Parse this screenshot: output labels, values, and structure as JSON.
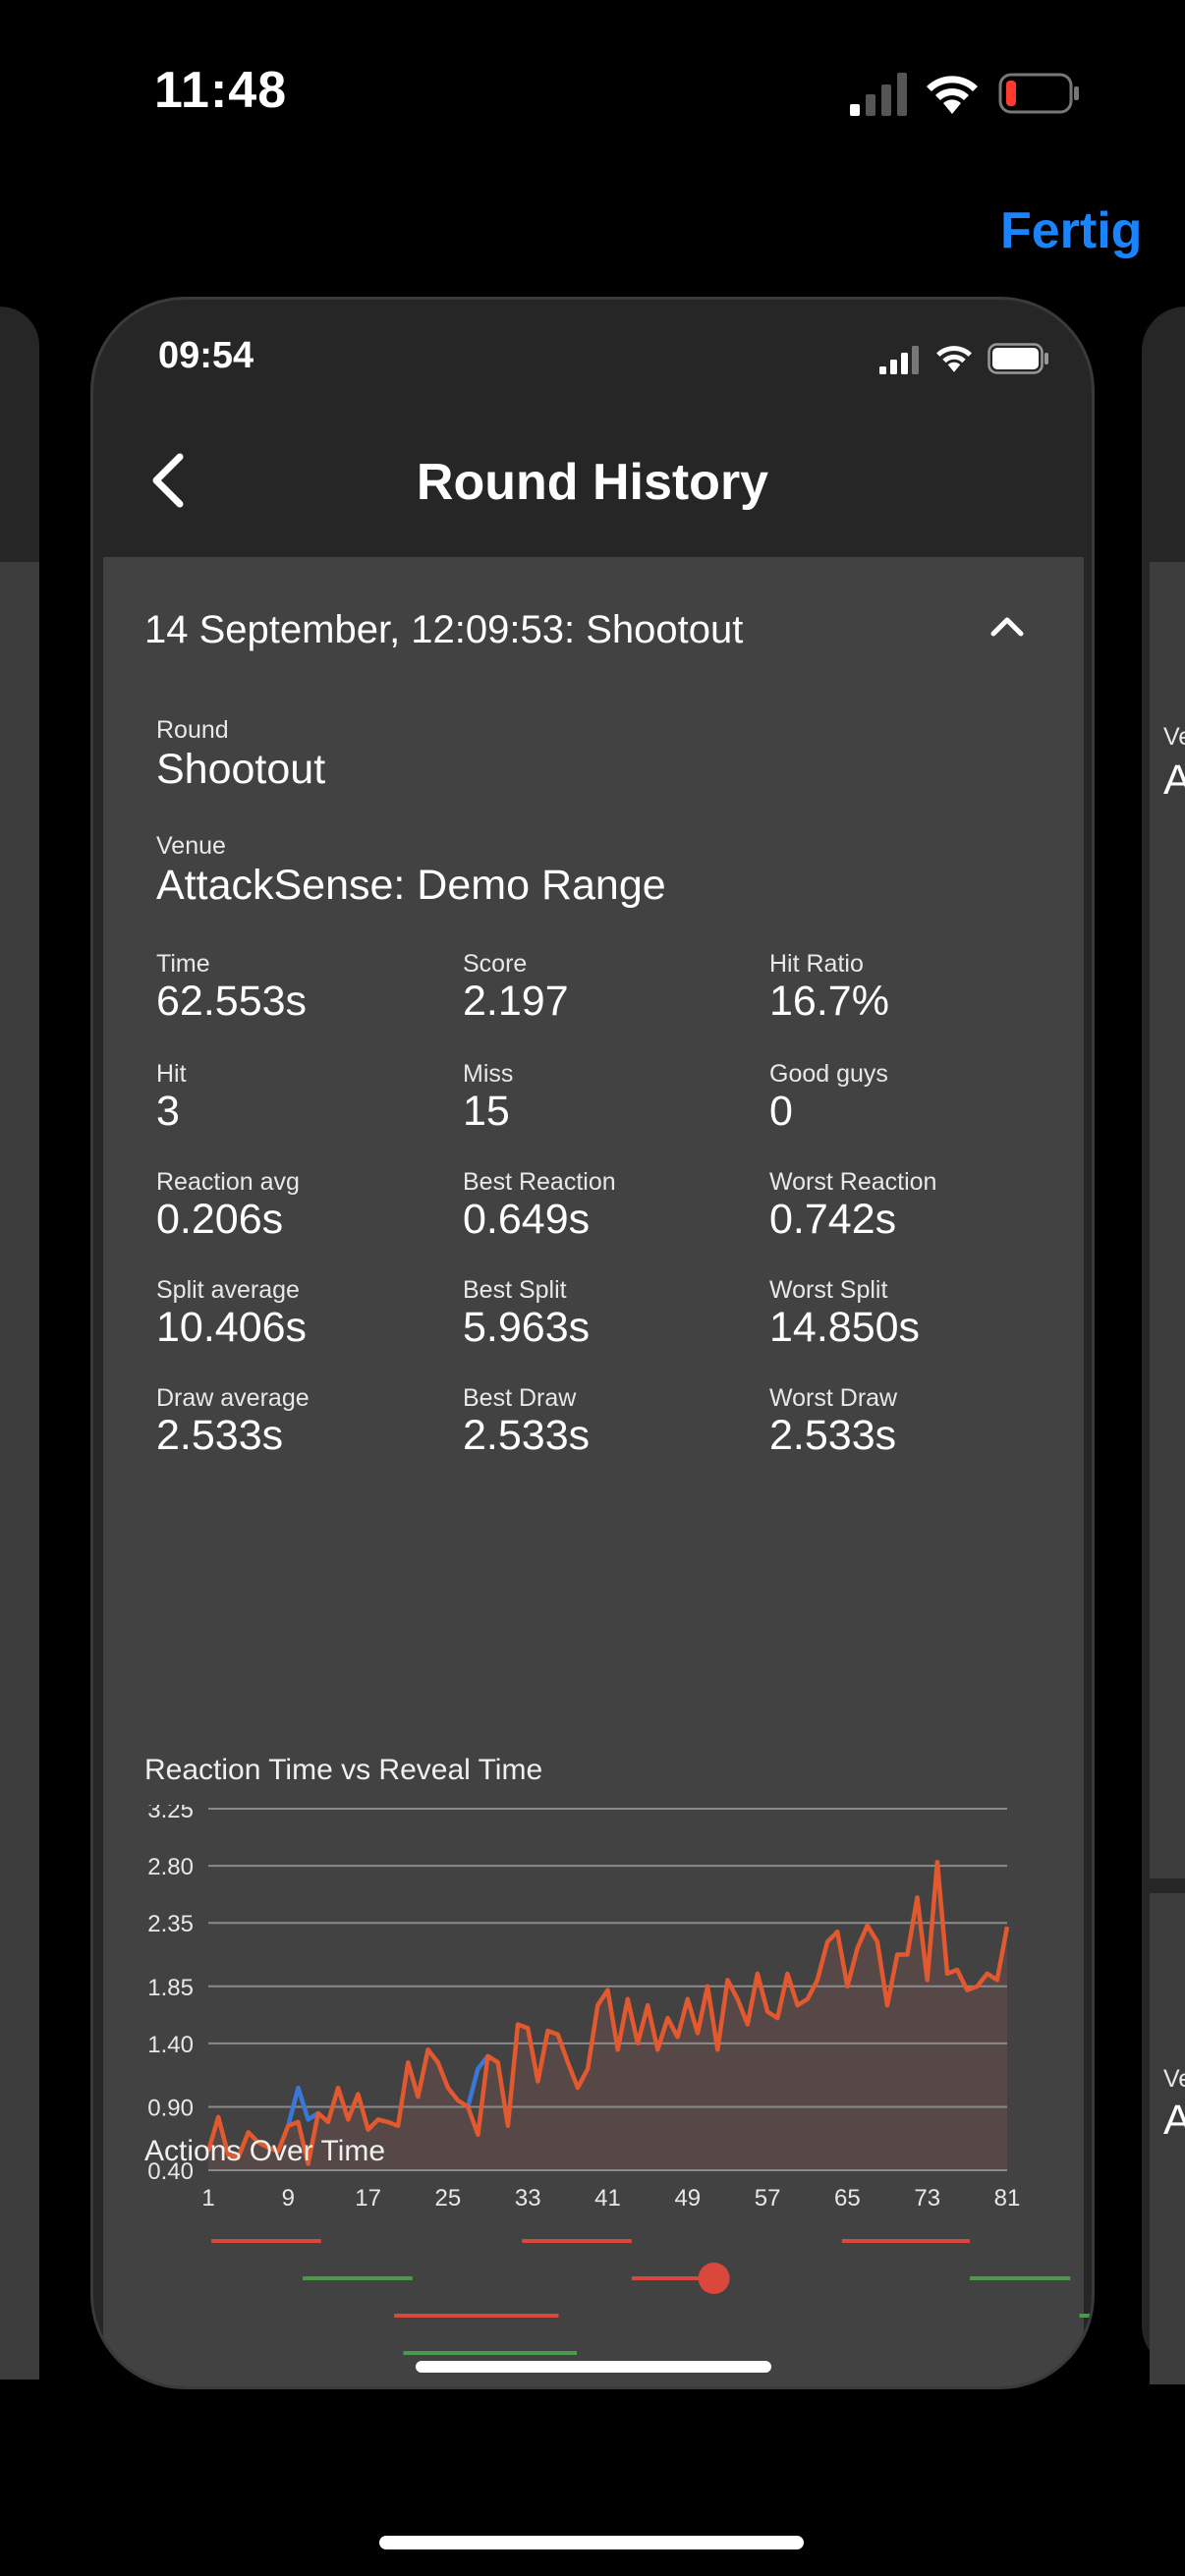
{
  "outer_status": {
    "time": "11:48"
  },
  "done_label": "Fertig",
  "inner_status": {
    "time": "09:54"
  },
  "nav": {
    "title": "Round History"
  },
  "round_header": "14 September, 12:09:53: Shootout",
  "summary": {
    "round_label": "Round",
    "round_value": "Shootout",
    "venue_label": "Venue",
    "venue_value": "AttackSense: Demo Range"
  },
  "stats": [
    [
      {
        "label": "Time",
        "value": "62.553s"
      },
      {
        "label": "Score",
        "value": "2.197"
      },
      {
        "label": "Hit Ratio",
        "value": "16.7%"
      }
    ],
    [
      {
        "label": "Hit",
        "value": "3"
      },
      {
        "label": "Miss",
        "value": "15"
      },
      {
        "label": "Good guys",
        "value": "0"
      }
    ],
    [
      {
        "label": "Reaction avg",
        "value": "0.206s"
      },
      {
        "label": "Best Reaction",
        "value": "0.649s"
      },
      {
        "label": "Worst Reaction",
        "value": "0.742s"
      }
    ],
    [
      {
        "label": "Split average",
        "value": "10.406s"
      },
      {
        "label": "Best Split",
        "value": "5.963s"
      },
      {
        "label": "Worst Split",
        "value": "14.850s"
      }
    ],
    [
      {
        "label": "Draw average",
        "value": "2.533s"
      },
      {
        "label": "Best Draw",
        "value": "2.533s"
      },
      {
        "label": "Worst Draw",
        "value": "2.533s"
      }
    ]
  ],
  "reaction_chart_title": "Reaction Time vs Reveal Time",
  "actions_title": "Actions Over Time",
  "side_cards": {
    "right_label": "Ve",
    "right_value": "A",
    "right_label_2": "Ve",
    "right_value_2": "A"
  },
  "chart_data": {
    "type": "area",
    "title": "",
    "xlabel": "",
    "ylabel": "",
    "y_ticks": [
      "3.25",
      "2.80",
      "2.35",
      "1.85",
      "1.40",
      "0.90",
      "0.40"
    ],
    "x_ticks": [
      "1",
      "9",
      "17",
      "25",
      "33",
      "41",
      "49",
      "57",
      "65",
      "73",
      "81"
    ],
    "xlim": [
      1,
      81
    ],
    "ylim": [
      0.4,
      3.25
    ],
    "grid": true,
    "colors": {
      "main": "#e2582f",
      "highlight": "#3a78d8",
      "fill": "#5b4a48"
    },
    "series": [
      {
        "color": "#e2582f",
        "x": [
          1,
          2,
          3,
          4,
          5,
          6,
          7,
          8,
          9,
          10,
          11,
          12,
          13,
          14,
          15,
          16,
          17,
          18,
          19,
          20,
          21,
          22,
          23,
          24,
          25,
          26,
          27,
          28,
          29,
          30,
          31,
          32,
          33,
          34,
          35,
          36,
          37,
          38,
          39,
          40,
          41,
          42,
          43,
          44,
          45,
          46,
          47,
          48,
          49,
          50,
          51,
          52,
          53,
          54,
          55,
          56,
          57,
          58,
          59,
          60,
          61,
          62,
          63,
          64,
          65,
          66,
          67,
          68,
          69,
          70,
          71,
          72,
          73,
          74,
          75,
          76,
          77,
          78,
          79,
          80,
          81
        ],
        "values": [
          0.55,
          0.82,
          0.52,
          0.5,
          0.7,
          0.62,
          0.58,
          0.55,
          0.75,
          0.78,
          0.45,
          0.85,
          0.78,
          1.05,
          0.8,
          1.0,
          0.72,
          0.8,
          0.78,
          0.75,
          1.25,
          0.98,
          1.35,
          1.25,
          1.05,
          0.95,
          0.9,
          0.68,
          1.3,
          1.25,
          0.75,
          1.55,
          1.52,
          1.1,
          1.5,
          1.47,
          1.25,
          1.05,
          1.2,
          1.7,
          1.82,
          1.35,
          1.75,
          1.4,
          1.7,
          1.35,
          1.6,
          1.45,
          1.75,
          1.48,
          1.85,
          1.35,
          1.9,
          1.75,
          1.55,
          1.95,
          1.65,
          1.6,
          1.95,
          1.7,
          1.75,
          1.9,
          2.2,
          2.28,
          1.85,
          2.15,
          2.33,
          2.2,
          1.7,
          2.1,
          2.1,
          2.55,
          1.9,
          2.83,
          1.95,
          1.98,
          1.82,
          1.85,
          1.95,
          1.9,
          2.32
        ]
      },
      {
        "color": "#3a78d8",
        "x": [
          9,
          10,
          11,
          12,
          27,
          28,
          29
        ],
        "values": [
          0.75,
          1.05,
          0.8,
          0.85,
          0.9,
          1.2,
          1.3
        ]
      }
    ]
  },
  "actions_chart": {
    "segments": [
      {
        "color": "#d9473d",
        "lane": 0,
        "x0": 0.07,
        "x1": 0.19
      },
      {
        "color": "#d9473d",
        "lane": 0,
        "x0": 0.41,
        "x1": 0.53
      },
      {
        "color": "#d9473d",
        "lane": 0,
        "x0": 0.76,
        "x1": 0.9
      },
      {
        "color": "#4a9a4a",
        "lane": 1,
        "x0": 0.17,
        "x1": 0.29
      },
      {
        "color": "#d9473d",
        "lane": 1,
        "x0": 0.53,
        "x1": 0.63
      },
      {
        "color": "#4a9a4a",
        "lane": 1,
        "x0": 0.9,
        "x1": 1.01
      },
      {
        "color": "#d9473d",
        "lane": 2,
        "x0": 0.27,
        "x1": 0.45
      },
      {
        "color": "#4a9a4a",
        "lane": 2,
        "x0": 1.02,
        "x1": 1.15
      },
      {
        "color": "#4a9a4a",
        "lane": 3,
        "x0": 0.28,
        "x1": 0.47
      },
      {
        "color": "#4a9a4a",
        "lane": 3,
        "x0": 1.06,
        "x1": 1.15
      }
    ],
    "marker": {
      "color": "#d9473d",
      "lane": 1,
      "x": 0.62
    }
  }
}
